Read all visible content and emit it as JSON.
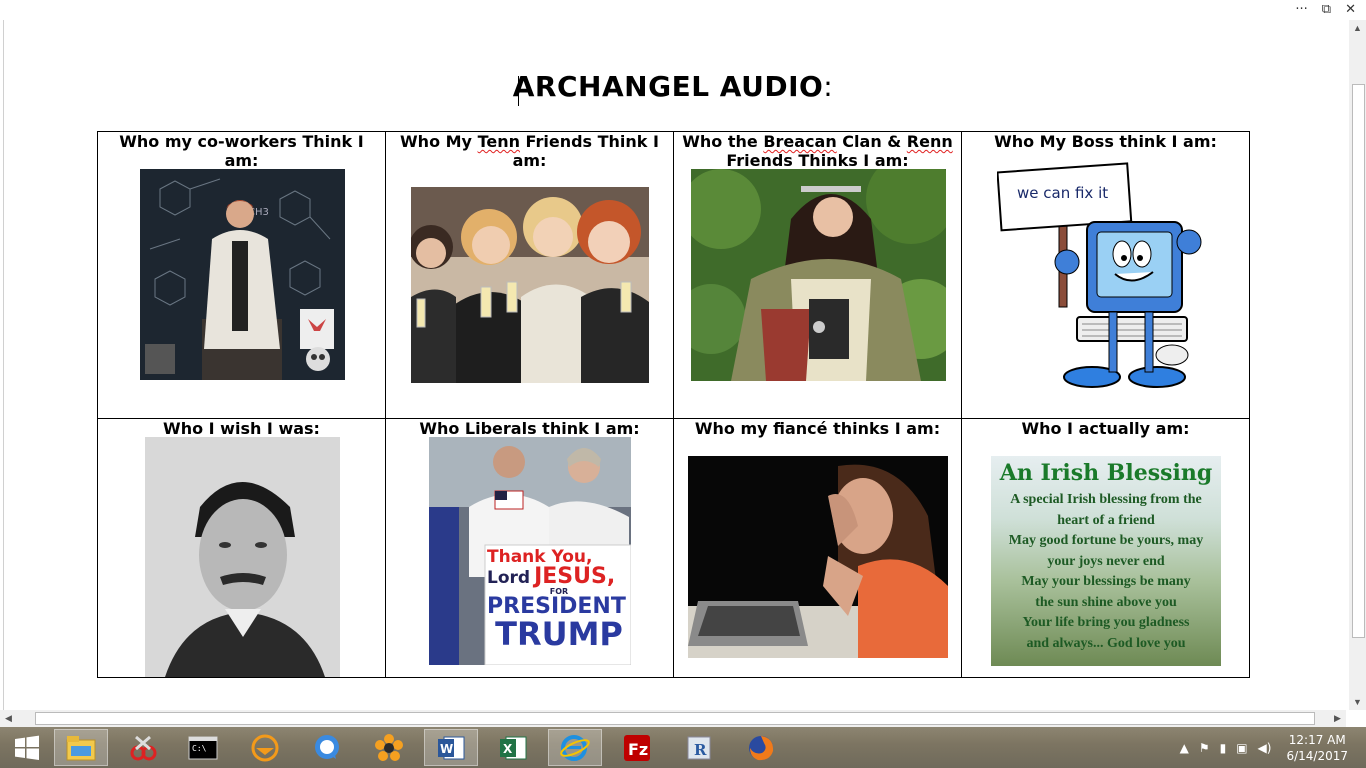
{
  "window": {
    "controls": [
      "···",
      "⧉",
      "✕"
    ]
  },
  "document": {
    "title": "ARCHANGEL AUDIO",
    "title_colon": ":",
    "cells": [
      {
        "caption": "Who my co-workers Think I am:"
      },
      {
        "caption_a": "Who My ",
        "caption_b": "Tenn",
        "caption_c": " Friends Think I am:"
      },
      {
        "caption_a": "Who the ",
        "caption_b": "Breacan",
        "caption_c": " Clan & ",
        "caption_d": "Renn",
        "caption_e": " Friends Thinks I am:"
      },
      {
        "caption": "Who My Boss think I am:",
        "sign_text": "we can fix it"
      },
      {
        "caption": "Who I wish I was:"
      },
      {
        "caption": "Who Liberals think I am:",
        "sign_lines": [
          "Thank You,",
          "Lord",
          "JESUS,",
          "FOR",
          "PRESIDENT",
          "TRUMP"
        ]
      },
      {
        "caption": "Who my fiancé thinks I am:"
      },
      {
        "caption": "Who I actually am:",
        "blessing_title": "An Irish Blessing",
        "blessing_lines": [
          "A special Irish blessing from the",
          "heart of a friend",
          "May good fortune be yours, may",
          "your joys never end",
          "May your blessings be many",
          "the sun shine above you",
          "Your life bring you gladness",
          "and always... God love you"
        ]
      }
    ]
  },
  "taskbar": {
    "apps": [
      "start-icon",
      "file-explorer-icon",
      "snipping-tool-icon",
      "command-prompt-icon",
      "mail-client-icon",
      "chat-icon",
      "flower-app-icon",
      "word-icon",
      "excel-icon",
      "internet-explorer-icon",
      "filezilla-icon",
      "r-app-icon",
      "firefox-icon"
    ],
    "clock_time": "12:17 AM",
    "clock_date": "6/14/2017"
  }
}
